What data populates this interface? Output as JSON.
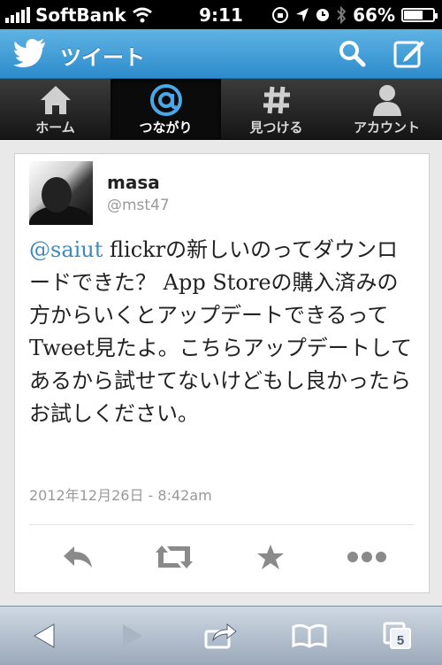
{
  "status_bar": {
    "carrier": "SoftBank",
    "time": "9:11",
    "battery": "66%",
    "battery_level": 0.66
  },
  "header": {
    "title": "ツイート",
    "icons": [
      "twitter-bird-icon",
      "search-icon",
      "compose-icon"
    ]
  },
  "tabs": [
    {
      "label": "ホーム",
      "icon": "home-icon",
      "active": false
    },
    {
      "label": "つながり",
      "icon": "at-icon",
      "active": true
    },
    {
      "label": "見つける",
      "icon": "hash-icon",
      "active": false
    },
    {
      "label": "アカウント",
      "icon": "person-icon",
      "active": false
    }
  ],
  "tweet": {
    "name": "masa",
    "handle": "@mst47",
    "mention": "@saiut",
    "text": " flickrの新しいのってダウンロードできた？ App Storeの購入済みの方からいくとアップデートできるってTweet見たよ。こちらアップデートしてあるから試せてないけどもし良かったらお試しください。",
    "timestamp": "2012年12月26日 - 8:42am",
    "actions": [
      "reply-icon",
      "retweet-icon",
      "favorite-icon",
      "more-icon"
    ]
  },
  "toolbar": {
    "tabs_count": "5",
    "icons": [
      "back-icon",
      "forward-icon",
      "share-icon",
      "bookmarks-icon",
      "pages-icon"
    ]
  },
  "colors": {
    "header_top": "#5fb3e3",
    "header_bottom": "#2d8ccc",
    "mention": "#3b88c3"
  }
}
